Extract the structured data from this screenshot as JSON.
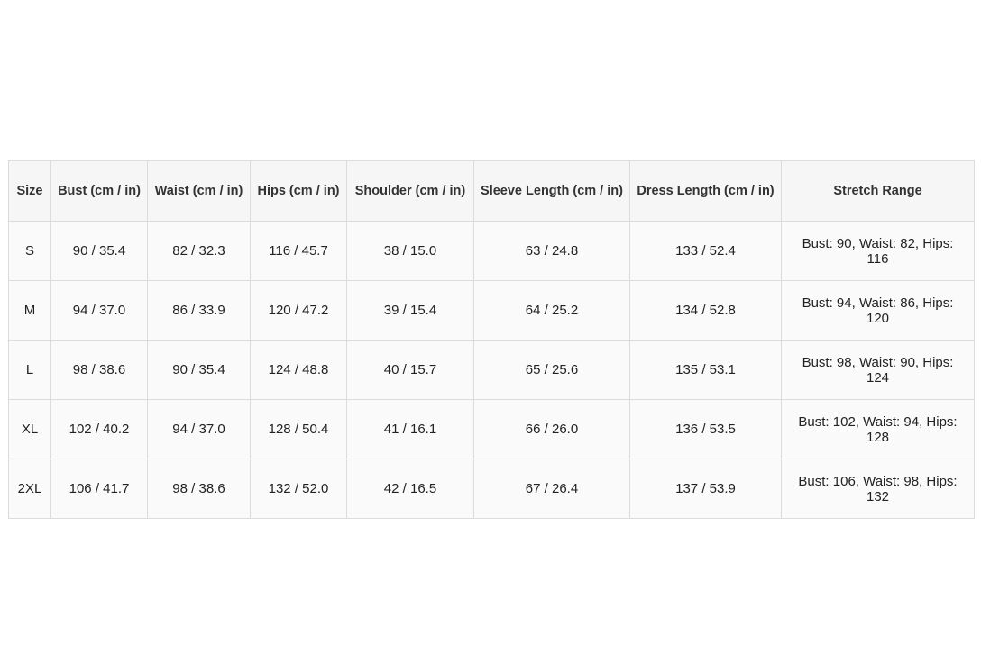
{
  "table": {
    "headers": [
      "Size",
      "Bust (cm / in)",
      "Waist (cm / in)",
      "Hips (cm / in)",
      "Shoulder (cm / in)",
      "Sleeve Length (cm / in)",
      "Dress Length (cm / in)",
      "Stretch Range"
    ],
    "rows": [
      [
        "S",
        "90 / 35.4",
        "82 / 32.3",
        "116 / 45.7",
        "38 / 15.0",
        "63 / 24.8",
        "133 / 52.4",
        "Bust: 90, Waist: 82, Hips: 116"
      ],
      [
        "M",
        "94 / 37.0",
        "86 / 33.9",
        "120 / 47.2",
        "39 / 15.4",
        "64 / 25.2",
        "134 / 52.8",
        "Bust: 94, Waist: 86, Hips: 120"
      ],
      [
        "L",
        "98 / 38.6",
        "90 / 35.4",
        "124 / 48.8",
        "40 / 15.7",
        "65 / 25.6",
        "135 / 53.1",
        "Bust: 98, Waist: 90, Hips: 124"
      ],
      [
        "XL",
        "102 / 40.2",
        "94 / 37.0",
        "128 / 50.4",
        "41 / 16.1",
        "66 / 26.0",
        "136 / 53.5",
        "Bust: 102, Waist: 94, Hips: 128"
      ],
      [
        "2XL",
        "106 / 41.7",
        "98 / 38.6",
        "132 / 52.0",
        "42 / 16.5",
        "67 / 26.4",
        "137 / 53.9",
        "Bust: 106, Waist: 98, Hips: 132"
      ]
    ]
  },
  "colors": {
    "border": "#dcdcdc",
    "header_bg": "#f6f6f6",
    "cell_bg": "#fafafa",
    "text": "#222222"
  }
}
